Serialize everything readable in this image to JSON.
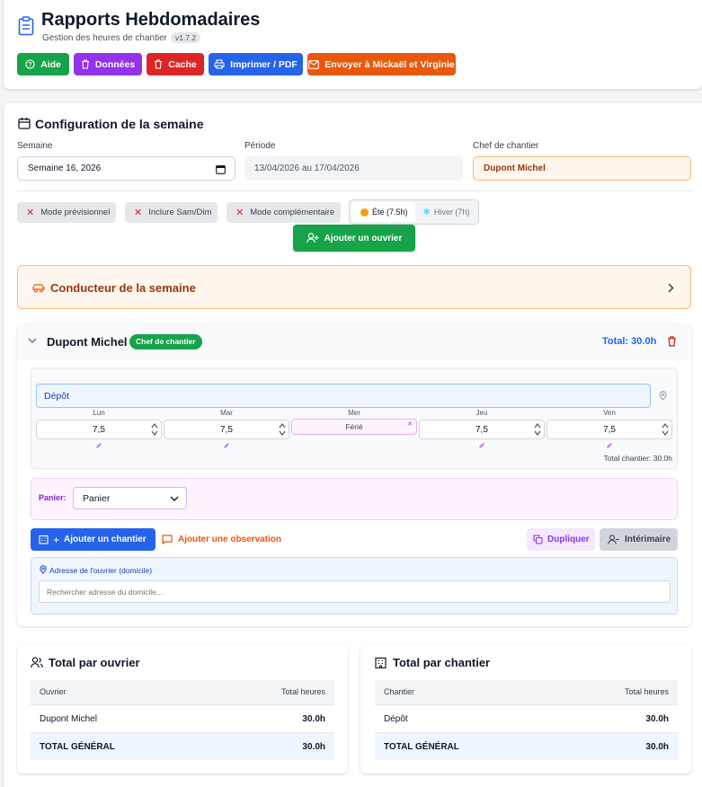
{
  "header": {
    "title": "Rapports Hebdomadaires",
    "subtitle": "Gestion des heures de chantier",
    "version": "v1.7.2",
    "buttons": {
      "aide": "Aide",
      "donnees": "Données",
      "cache": "Cache",
      "imprimer": "Imprimer / PDF",
      "envoyer": "Envoyer à Mickaël et Virginie"
    }
  },
  "config": {
    "title": "Configuration de la semaine",
    "semaine_label": "Semaine",
    "semaine_value": "Semaine 16, 2026",
    "periode_label": "Période",
    "periode_value": "13/04/2026 au 17/04/2026",
    "chef_label": "Chef de chantier",
    "chef_value": "Dupont Michel",
    "modes": {
      "previsionnel": "Mode prévisionnel",
      "samdim": "Inclure Sam/Dim",
      "complementaire": "Mode complémentaire"
    },
    "season": {
      "ete": "Été (7.5h)",
      "hiver": "Hiver (7h)"
    },
    "add_worker": "Ajouter un ouvrier"
  },
  "conducteur": {
    "title": "Conducteur de la semaine"
  },
  "worker": {
    "name": "Dupont Michel",
    "badge": "Chef de chantier",
    "total": "Total: 30.0h",
    "site_name": "Dépôt",
    "days": [
      {
        "label": "Lun",
        "value": "7,5"
      },
      {
        "label": "Mar",
        "value": "7,5"
      },
      {
        "label": "Mer",
        "value": "Férié"
      },
      {
        "label": "Jeu",
        "value": "7,5"
      },
      {
        "label": "Ven",
        "value": "7,5"
      }
    ],
    "site_total": "Total chantier: 30.0h",
    "panier_label": "Panier:",
    "panier_value": "Panier",
    "add_site": "Ajouter un chantier",
    "add_observation": "Ajouter une observation",
    "duplicate": "Dupliquer",
    "interimaire": "Intérimaire",
    "address_label": "Adresse de l'ouvrier (domicile)",
    "address_placeholder": "Rechercher adresse du domicile..."
  },
  "total_ouvrier": {
    "title": "Total par ouvrier",
    "col1": "Ouvrier",
    "col2": "Total heures",
    "rows": [
      {
        "name": "Dupont Michel",
        "hours": "30.0h"
      }
    ],
    "total_label": "TOTAL GÉNÉRAL",
    "total_value": "30.0h"
  },
  "total_chantier": {
    "title": "Total par chantier",
    "col1": "Chantier",
    "col2": "Total heures",
    "rows": [
      {
        "name": "Dépôt",
        "hours": "30.0h"
      }
    ],
    "total_label": "TOTAL GÉNÉRAL",
    "total_value": "30.0h"
  },
  "colors": {
    "green": "#16a34a",
    "purple": "#9333ea",
    "red": "#dc2626",
    "blue": "#2563eb",
    "orange": "#ea580c"
  }
}
